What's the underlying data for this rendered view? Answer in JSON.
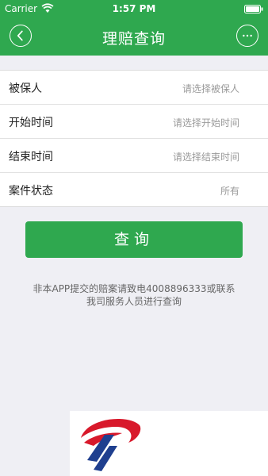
{
  "status_bar": {
    "carrier": "Carrier",
    "time": "1:57 PM"
  },
  "nav": {
    "title": "理赔查询",
    "back_icon": "chevron-left-icon",
    "more_icon": "ellipsis-icon"
  },
  "form": {
    "fields": [
      {
        "label": "被保人",
        "placeholder": "请选择被保人"
      },
      {
        "label": "开始时间",
        "placeholder": "请选择开始时间"
      },
      {
        "label": "结束时间",
        "placeholder": "请选择结束时间"
      },
      {
        "label": "案件状态",
        "value": "所有"
      }
    ]
  },
  "query_button": {
    "label": "查询"
  },
  "note": {
    "line1": "非本APP提交的赔案请致电4008896333或联系",
    "line2": "我司服务人员进行查询"
  },
  "colors": {
    "accent": "#2fa84f",
    "logo_red": "#d8192b",
    "logo_blue": "#1f3f8f"
  }
}
